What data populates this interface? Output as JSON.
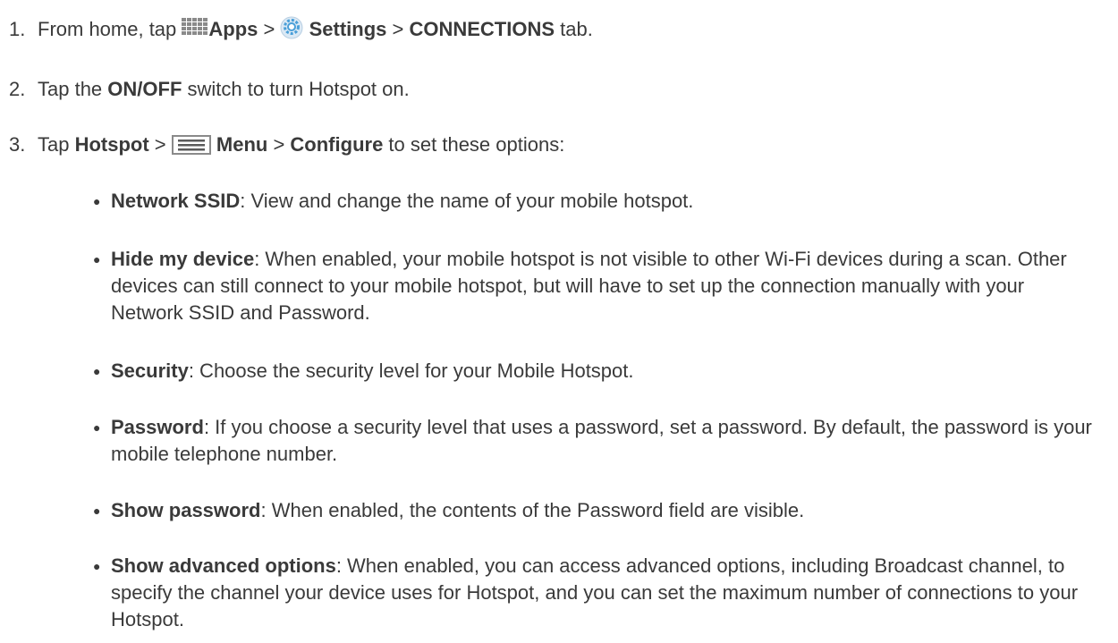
{
  "steps": [
    {
      "num": "1.",
      "t1": "From home, tap ",
      "apps": "Apps",
      "t2": " > ",
      "settings": "Settings",
      "t3": " > ",
      "connections": "CONNECTIONS",
      "t4": " tab."
    },
    {
      "num": "2.",
      "t1": "Tap the ",
      "onoff": "ON/OFF",
      "t2": " switch to turn Hotspot on."
    },
    {
      "num": "3.",
      "t1": "Tap ",
      "hotspot": "Hotspot",
      "t2": " > ",
      "menu": "Menu",
      "t3": " > ",
      "configure": "Configure",
      "t4": " to set these options:"
    }
  ],
  "options": [
    {
      "term": "Network SSID",
      "desc": ": View and change the name of your mobile hotspot."
    },
    {
      "term": "Hide my device",
      "desc": ": When enabled, your mobile hotspot is not visible to other Wi-Fi devices during a scan. Other devices can still connect to your mobile hotspot, but will have to set up the connection manually with your Network SSID and Password."
    },
    {
      "term": "Security",
      "desc": ": Choose the security level for your Mobile Hotspot."
    },
    {
      "term": "Password",
      "desc": ": If you choose a security level that uses a password, set a password. By default, the password is your mobile telephone number."
    },
    {
      "term": "Show password",
      "desc": ": When enabled, the contents of the Password field are visible."
    },
    {
      "term": "Show advanced options",
      "desc": ": When enabled, you can access advanced options, including Broadcast channel, to specify the channel your device uses for Hotspot, and you can set the maximum number of connections to your Hotspot."
    }
  ],
  "icons": {
    "apps": "apps-grid-icon",
    "settings": "settings-gear-icon",
    "menu": "menu-icon"
  },
  "colors": {
    "text": "#3a3a3a",
    "icon_gray": "#8a8a8a",
    "settings_blue": "#4a9fd8"
  }
}
